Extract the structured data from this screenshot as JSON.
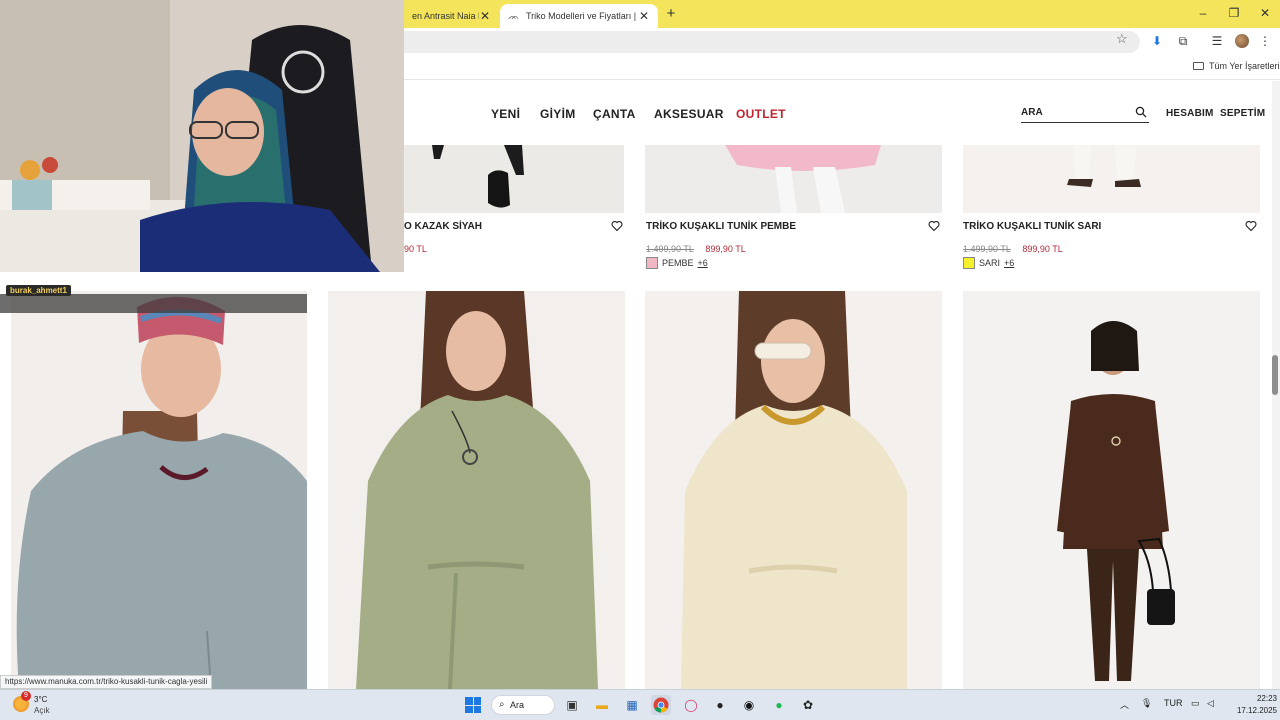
{
  "browser": {
    "tabs": [
      {
        "label": "en Antrasit Naia Pan",
        "active": false
      },
      {
        "label": "Triko Modelleri ve Fiyatları | Ma",
        "active": true
      }
    ],
    "new_tab_symbol": "+",
    "bookmarks_folder": "Tüm Yer İşaretleri",
    "status_url": "https://www.manuka.com.tr/triko-kusakli-tunik-cagla-yesili"
  },
  "site": {
    "nav": [
      "YENİ",
      "GİYİM",
      "ÇANTA",
      "AKSESUAR",
      "OUTLET"
    ],
    "search_placeholder": "ARA",
    "account_label": "HESABIM",
    "cart_label": "SEPETİM",
    "accent_color": "#c0232f"
  },
  "products_top": [
    {
      "name": "O KAZAK SİYAH",
      "old_price": "",
      "price": "90 TL",
      "swatch_color": "",
      "color_name": "",
      "more": ""
    },
    {
      "name": "TRİKO KUŞAKLI TUNİK PEMBE",
      "old_price": "1.499,90 TL",
      "price": "899,90 TL",
      "swatch_color": "#f2b7c4",
      "color_name": "PEMBE",
      "more": "+6"
    },
    {
      "name": "TRİKO KUŞAKLI TUNİK SARI",
      "old_price": "1.499,90 TL",
      "price": "899,90 TL",
      "swatch_color": "#f4f02a",
      "color_name": "SARI",
      "more": "+6"
    }
  ],
  "stream": {
    "chat_user": "burak_ahmett1"
  },
  "taskbar": {
    "weather_badge": "9",
    "temperature": "3°C",
    "weather_desc": "Açık",
    "search_label": "Ara",
    "language": "TUR",
    "time": "22:23",
    "date": "17.12.2025"
  }
}
